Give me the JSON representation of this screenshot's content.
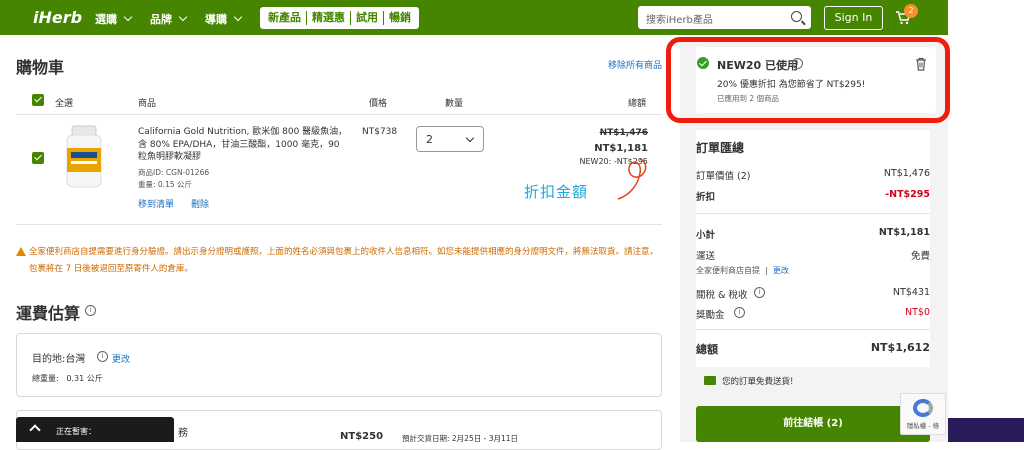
{
  "nav": {
    "logo": "iHerb",
    "menus": [
      "選購",
      "品牌",
      "導購"
    ],
    "promos": [
      "新產品",
      "精選惠",
      "試用",
      "暢銷"
    ],
    "search_placeholder": "搜索iHerb產品",
    "signin": "Sign In",
    "cart_count": "2",
    "icons": [
      "search-icon",
      "cart-icon"
    ]
  },
  "cart": {
    "title": "購物車",
    "remove_all": "移除所有商品",
    "headers": {
      "select_all": "全選",
      "product": "商品",
      "price": "價格",
      "qty": "數量",
      "total": "總額"
    },
    "item": {
      "name": "California Gold Nutrition, 歐米伽 800 醫級魚油，含 80% EPA/DHA，甘油三酸酯，1000 毫克，90 粒魚明膠軟凝膠",
      "product_id": "商品ID: CGN-01266",
      "weight": "重量: 0.15 公斤",
      "move_to_list": "移到清單",
      "delete": "刪除",
      "price": "NT$738",
      "qty": "2",
      "original_total": "NT$1,476",
      "final_total": "NT$1,181",
      "discount_label": "NEW20: -NT$295"
    },
    "annotation": "折扣金額",
    "warning": "全家便利商店自提需要進行身分驗證。請出示身分證明或護照，上面的姓名必須與包裹上的收件人信息相符。如您未能提供相應的身分證明文件，將無法取貨。請注意，包裹將在 7 日後被退回至原寄件人的倉庫。"
  },
  "shipping": {
    "title": "運費估算",
    "destination": "目的地:台灣",
    "change": "更改",
    "total_weight": "總重量:",
    "total_weight_value": "0.31 公斤",
    "partial_service": "務",
    "partial_price": "NT$250",
    "partial_date": "預計交貨日期: 2月25日 - 3月11日"
  },
  "bottom_bar": {
    "label": "正在暫害："
  },
  "coupon": {
    "title": "NEW20 已使用",
    "description": "20% 優惠折扣 為您節省了 NT$295!",
    "applied": "已應用到 2 個商品"
  },
  "summary": {
    "title": "訂單匯總",
    "rows": {
      "order_value_label": "訂單價值 (2)",
      "order_value": "NT$1,476",
      "discount_label": "折扣",
      "discount": "-NT$295",
      "subtotal_label": "小計",
      "subtotal": "NT$1,181",
      "shipping_label": "運送",
      "shipping": "免費",
      "pickup_label": "全家便利商店自提",
      "pickup_change": "更改",
      "tax_label": "關稅 & 稅收",
      "tax": "NT$431",
      "rewards_label": "獎勵金",
      "rewards": "NT$0",
      "total_label": "總額",
      "total": "NT$1,612"
    },
    "free_shipping": "您的訂單免費送貨!",
    "checkout": "前往結帳 (2)"
  },
  "recaptcha": {
    "label": "隱私權 - 條"
  },
  "colors": {
    "brand": "#458500",
    "link": "#1a6fc0",
    "discount": "#d0021b",
    "highlight": "#ee1d0e",
    "annotation": "#1ea8e0"
  }
}
